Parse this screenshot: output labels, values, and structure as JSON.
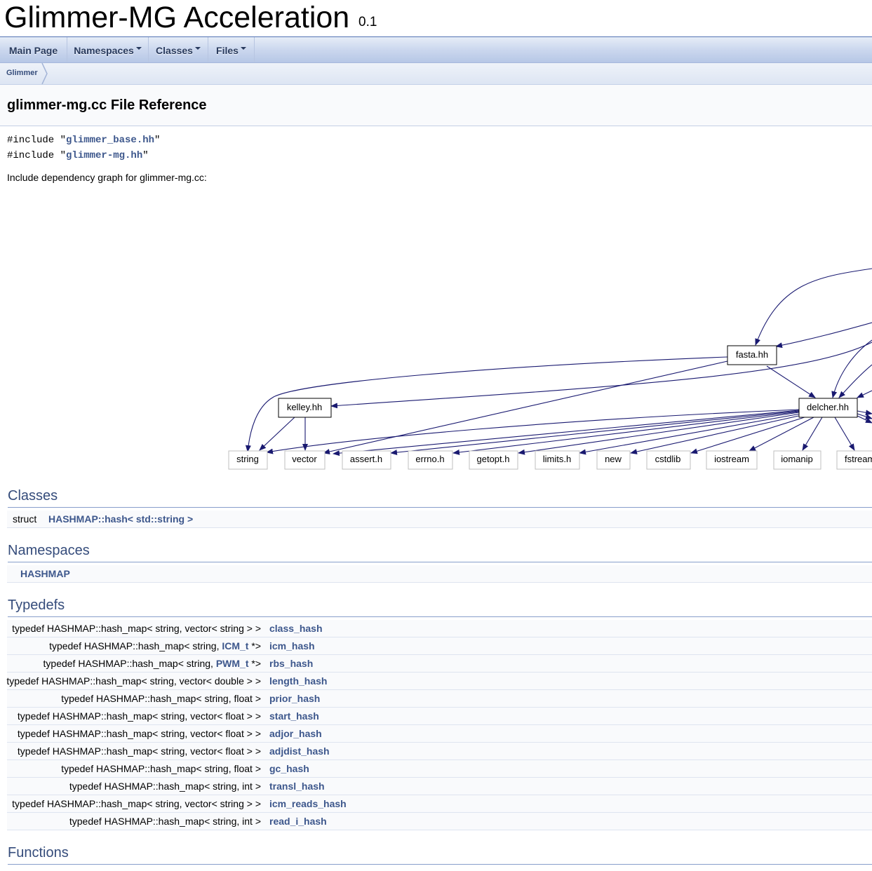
{
  "project": {
    "name": "Glimmer-MG Acceleration",
    "number": "0.1"
  },
  "navbar": [
    {
      "label": "Main Page",
      "dropdown": false
    },
    {
      "label": "Namespaces",
      "dropdown": true
    },
    {
      "label": "Classes",
      "dropdown": true
    },
    {
      "label": "Files",
      "dropdown": true
    }
  ],
  "breadcrumb": {
    "label": "Glimmer"
  },
  "page_title": "glimmer-mg.cc File Reference",
  "includes": [
    {
      "prefix": "#include \"",
      "file": "glimmer_base.hh",
      "suffix": "\""
    },
    {
      "prefix": "#include \"",
      "file": "glimmer-mg.hh",
      "suffix": "\""
    }
  ],
  "graph": {
    "caption": "Include dependency graph for glimmer-mg.cc:",
    "nodes": {
      "fasta": "fasta.hh",
      "kelley": "kelley.hh",
      "delcher": "delcher.hh",
      "string": "string",
      "vector": "vector",
      "assert": "assert.h",
      "errno": "errno.h",
      "getopt": "getopt.h",
      "limits": "limits.h",
      "new": "new",
      "cstdlib": "cstdlib",
      "iostream": "iostream",
      "iomanip": "iomanip",
      "fstream": "fstream"
    }
  },
  "sections": {
    "classes": {
      "title": "Classes",
      "items": [
        {
          "type": "struct",
          "name": "HASHMAP::hash< std::string >"
        }
      ]
    },
    "namespaces": {
      "title": "Namespaces",
      "items": [
        {
          "name": "HASHMAP"
        }
      ]
    },
    "typedefs": {
      "title": "Typedefs",
      "rows": [
        {
          "pre": "typedef HASHMAP::hash_map< string, vector< string > >",
          "type_link": "",
          "post": "",
          "name": "class_hash"
        },
        {
          "pre": "typedef HASHMAP::hash_map< string, ",
          "type_link": "ICM_t",
          "post": " *>",
          "name": "icm_hash"
        },
        {
          "pre": "typedef HASHMAP::hash_map< string, ",
          "type_link": "PWM_t",
          "post": " *>",
          "name": "rbs_hash"
        },
        {
          "pre": "typedef HASHMAP::hash_map< string, vector< double > >",
          "type_link": "",
          "post": "",
          "name": "length_hash"
        },
        {
          "pre": "typedef HASHMAP::hash_map< string, float >",
          "type_link": "",
          "post": "",
          "name": "prior_hash"
        },
        {
          "pre": "typedef HASHMAP::hash_map< string, vector< float > >",
          "type_link": "",
          "post": "",
          "name": "start_hash"
        },
        {
          "pre": "typedef HASHMAP::hash_map< string, vector< float > >",
          "type_link": "",
          "post": "",
          "name": "adjor_hash"
        },
        {
          "pre": "typedef HASHMAP::hash_map< string, vector< float > >",
          "type_link": "",
          "post": "",
          "name": "adjdist_hash"
        },
        {
          "pre": "typedef HASHMAP::hash_map< string, float >",
          "type_link": "",
          "post": "",
          "name": "gc_hash"
        },
        {
          "pre": "typedef HASHMAP::hash_map< string, int >",
          "type_link": "",
          "post": "",
          "name": "transl_hash"
        },
        {
          "pre": "typedef HASHMAP::hash_map< string, vector< string > >",
          "type_link": "",
          "post": "",
          "name": "icm_reads_hash"
        },
        {
          "pre": "typedef HASHMAP::hash_map< string, int >",
          "type_link": "",
          "post": "",
          "name": "read_i_hash"
        }
      ]
    },
    "functions": {
      "title": "Functions"
    }
  }
}
